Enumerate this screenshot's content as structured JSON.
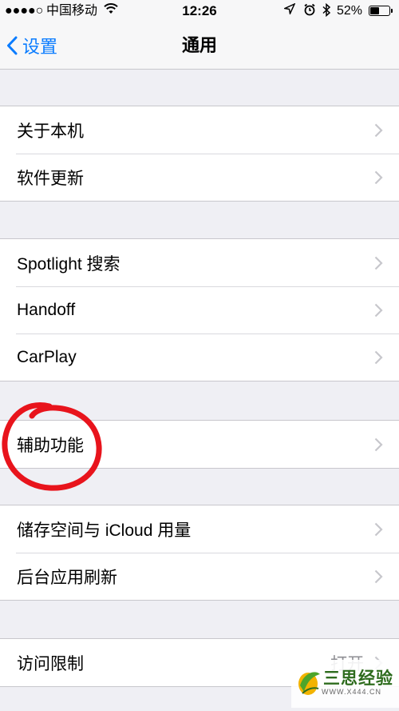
{
  "status_bar": {
    "signal": "●●●●○",
    "carrier": "中国移动",
    "time": "12:26",
    "battery_percent": "52%",
    "battery_level": 0.52
  },
  "nav": {
    "back_label": "设置",
    "title": "通用"
  },
  "groups": [
    {
      "items": [
        {
          "label": "关于本机"
        },
        {
          "label": "软件更新"
        }
      ]
    },
    {
      "items": [
        {
          "label": "Spotlight 搜索"
        },
        {
          "label": "Handoff"
        },
        {
          "label": "CarPlay"
        }
      ]
    },
    {
      "items": [
        {
          "label": "辅助功能"
        }
      ]
    },
    {
      "items": [
        {
          "label": "储存空间与 iCloud 用量"
        },
        {
          "label": "后台应用刷新"
        }
      ]
    },
    {
      "items": [
        {
          "label": "访问限制",
          "value": "打开"
        }
      ]
    }
  ],
  "watermark": {
    "name": "三思经验",
    "url": "WWW.X444.CN"
  },
  "colors": {
    "accent": "#0a7cff",
    "annotation": "#e8141c",
    "background": "#efeff4"
  }
}
